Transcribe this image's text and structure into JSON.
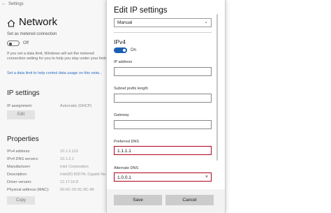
{
  "window": {
    "title": "Settings"
  },
  "background": {
    "page_title": "Network",
    "metered_label": "Set as metered connection",
    "metered_state": "Off",
    "data_limit_text": "If you set a data limit, Windows will set the metered connection setting for you to help you stay under your limit.",
    "data_limit_link": "Set a data limit to help control data usage on this netw...",
    "ip_settings_heading": "IP settings",
    "ip_assignment_label": "IP assignment:",
    "ip_assignment_value": "Automatic (DHCP)",
    "edit_button": "Edit",
    "properties_heading": "Properties",
    "properties": [
      {
        "label": "IPv4 address:",
        "value": "10.1.2.113"
      },
      {
        "label": "IPv4 DNS servers:",
        "value": "10.1.2.1"
      },
      {
        "label": "Manufacturer:",
        "value": "Intel Corporation"
      },
      {
        "label": "Description:",
        "value": "Intel(R) 82574L Gigabit Ne..."
      },
      {
        "label": "Driver version:",
        "value": "12.17.10.8"
      },
      {
        "label": "Physical address (MAC):",
        "value": "00-0C-29-3C-8C-68"
      }
    ],
    "copy_button": "Copy"
  },
  "dialog": {
    "title": "Edit IP settings",
    "mode_select": "Manual",
    "ipv4_heading": "IPv4",
    "ipv4_toggle_label": "On",
    "fields": {
      "ip_address": {
        "label": "IP address",
        "value": ""
      },
      "subnet": {
        "label": "Subnet prefix length",
        "value": ""
      },
      "gateway": {
        "label": "Gateway",
        "value": ""
      },
      "preferred_dns": {
        "label": "Preferred DNS",
        "value": "1.1.1.1"
      },
      "alternate_dns": {
        "label": "Alternate DNS",
        "value": "1.0.0.1"
      }
    },
    "save_button": "Save",
    "cancel_button": "Cancel"
  },
  "colors": {
    "accent": "#1a5fb4",
    "highlight_border": "#b00020",
    "link": "#2b6cc4"
  },
  "icons": [
    "back-arrow-icon",
    "home-icon",
    "chevron-down-icon",
    "clear-icon"
  ]
}
